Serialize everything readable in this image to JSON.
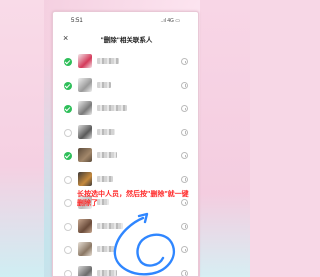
{
  "status": {
    "time": "5:51",
    "indicators": "..ıl 4G ▭"
  },
  "nav": {
    "close_glyph": "×",
    "title": "\"删除\"相关联系人"
  },
  "rows": [
    {
      "checked": true,
      "avatar_color": "#f3e6ea",
      "avatar_accent": "#d43a5a"
    },
    {
      "checked": true,
      "avatar_color": "#f0f0f0",
      "avatar_accent": "#9a9a9a"
    },
    {
      "checked": true,
      "avatar_color": "#ececec",
      "avatar_accent": "#7a7a7a"
    },
    {
      "checked": false,
      "avatar_color": "#dcdcdc",
      "avatar_accent": "#5a5a5a"
    },
    {
      "checked": true,
      "avatar_color": "#5b4a3a",
      "avatar_accent": "#a2876a"
    },
    {
      "checked": false,
      "avatar_color": "#3f3a38",
      "avatar_accent": "#c68a3d"
    },
    {
      "checked": false,
      "avatar_color": "#f2f2f2",
      "avatar_accent": "#bdbdbd"
    },
    {
      "checked": false,
      "avatar_color": "#c8a890",
      "avatar_accent": "#6a4b3a"
    },
    {
      "checked": false,
      "avatar_color": "#e8e0d6",
      "avatar_accent": "#8a7764"
    },
    {
      "checked": false,
      "avatar_color": "#d8d8d8",
      "avatar_accent": "#6b6b6b"
    }
  ],
  "annotation": "长按选中人员，然后按\"删除\"就一键删除了",
  "colors": {
    "check_green": "#2fbf5a",
    "annotation_red": "#ff2a2a",
    "swirl_blue": "#2f86ff"
  }
}
